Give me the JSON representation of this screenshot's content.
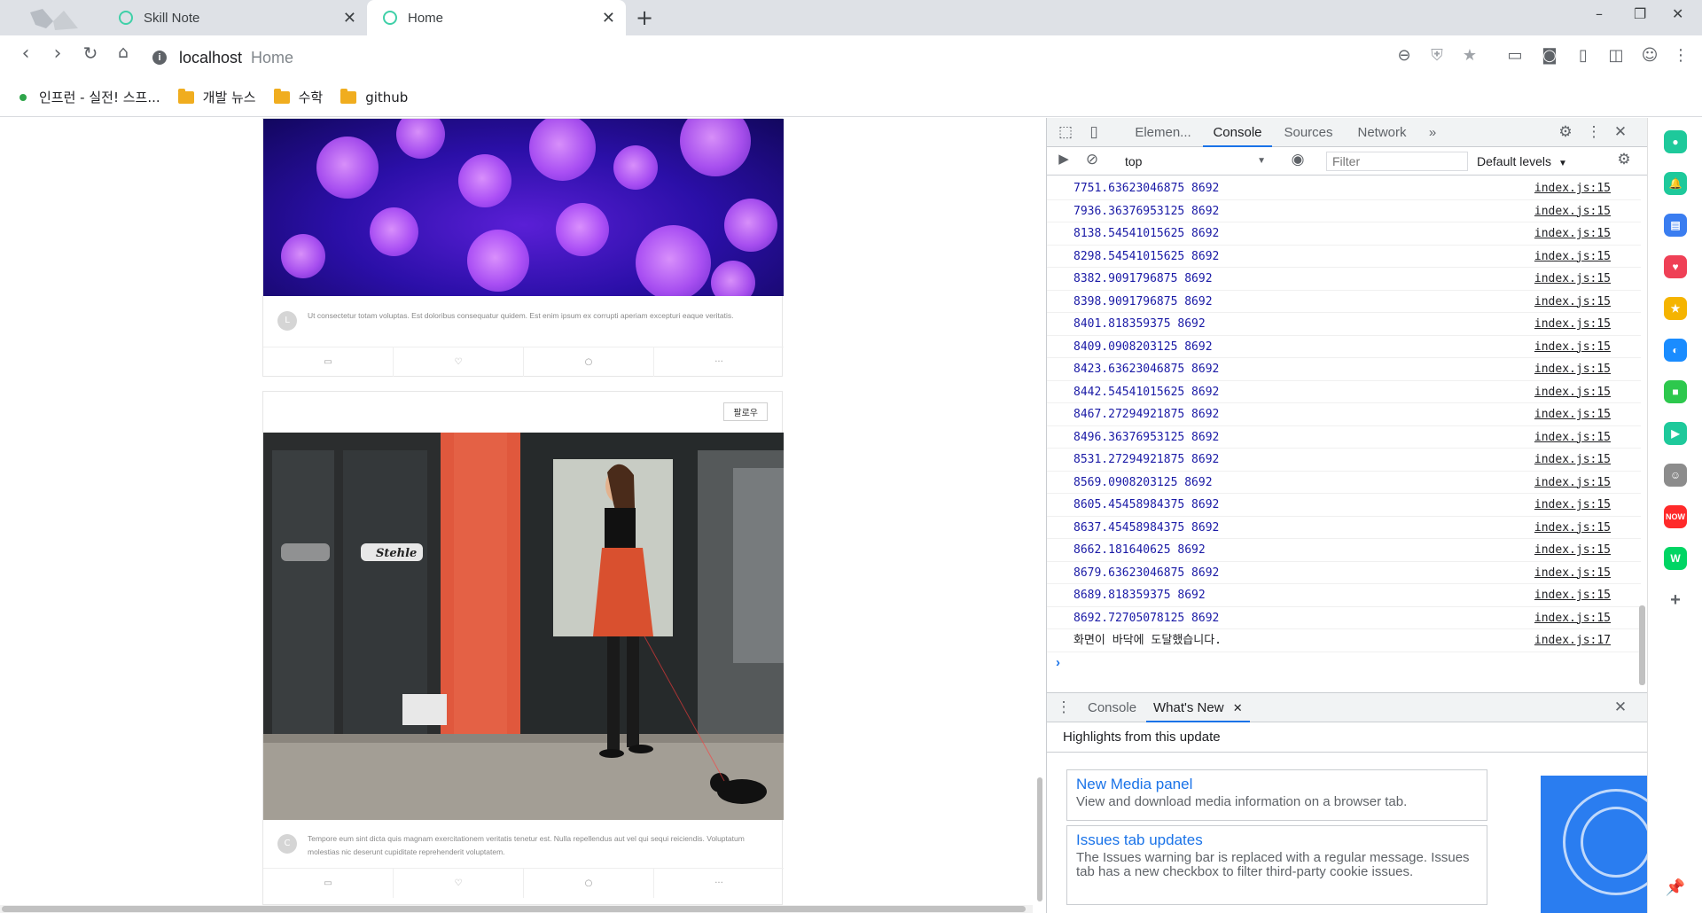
{
  "browser": {
    "tabs": [
      {
        "title": "Skill Note"
      },
      {
        "title": "Home"
      }
    ],
    "new_tab": "+",
    "window_controls": {
      "minimize": "–",
      "restore": "❐",
      "close": "✕"
    },
    "address": {
      "host": "localhost",
      "page_title": "Home",
      "info": "i"
    },
    "bookmarks": [
      {
        "label": "인프런 - 실전! 스프..."
      },
      {
        "label": "개발 뉴스"
      },
      {
        "label": "수학"
      },
      {
        "label": "github"
      }
    ]
  },
  "page": {
    "posts": [
      {
        "image": "purple-bokeh-photo",
        "avatar_initial": "L",
        "caption": "Ut consectetur totam voluptas. Est doloribus consequatur quidem. Est enim ipsum ex corrupti aperiam excepturi eaque veritatis.",
        "actions": [
          "▭",
          "♡",
          "○",
          "···"
        ]
      },
      {
        "follow_label": "팔로우",
        "image": "woman-walking-dog-photo",
        "avatar_initial": "C",
        "caption": "Tempore eum sint dicta quis magnam exercitationem veritatis tenetur est. Nulla repellendus aut vel qui sequi reiciendis. Voluptatum molestias nic deserunt cupiditate reprehenderit voluptatem.",
        "actions": [
          "▭",
          "♡",
          "○",
          "···"
        ]
      }
    ]
  },
  "devtools": {
    "tabs": [
      "Elemen...",
      "Console",
      "Sources",
      "Network",
      "»"
    ],
    "active_tab": "Console",
    "context": "top",
    "filter_placeholder": "Filter",
    "levels": "Default levels",
    "console_rows": [
      {
        "msg": "7751.63623046875 8692",
        "src": "index.js:15"
      },
      {
        "msg": "7936.36376953125 8692",
        "src": "index.js:15"
      },
      {
        "msg": "8138.54541015625 8692",
        "src": "index.js:15"
      },
      {
        "msg": "8298.54541015625 8692",
        "src": "index.js:15"
      },
      {
        "msg": "8382.9091796875 8692",
        "src": "index.js:15"
      },
      {
        "msg": "8398.9091796875 8692",
        "src": "index.js:15"
      },
      {
        "msg": "8401.818359375 8692",
        "src": "index.js:15"
      },
      {
        "msg": "8409.0908203125 8692",
        "src": "index.js:15"
      },
      {
        "msg": "8423.63623046875 8692",
        "src": "index.js:15"
      },
      {
        "msg": "8442.54541015625 8692",
        "src": "index.js:15"
      },
      {
        "msg": "8467.27294921875 8692",
        "src": "index.js:15"
      },
      {
        "msg": "8496.36376953125 8692",
        "src": "index.js:15"
      },
      {
        "msg": "8531.27294921875 8692",
        "src": "index.js:15"
      },
      {
        "msg": "8569.0908203125 8692",
        "src": "index.js:15"
      },
      {
        "msg": "8605.45458984375 8692",
        "src": "index.js:15"
      },
      {
        "msg": "8637.45458984375 8692",
        "src": "index.js:15"
      },
      {
        "msg": "8662.181640625 8692",
        "src": "index.js:15"
      },
      {
        "msg": "8679.63623046875 8692",
        "src": "index.js:15"
      },
      {
        "msg": "8689.818359375 8692",
        "src": "index.js:15"
      },
      {
        "msg": "8692.72705078125 8692",
        "src": "index.js:15"
      },
      {
        "msg": "화면이 바닥에 도달했습니다.",
        "src": "index.js:17",
        "plain": true
      }
    ],
    "drawer": {
      "tabs": [
        "Console",
        "What's New"
      ],
      "active_tab": "What's New",
      "highlights": "Highlights from this update",
      "items": [
        {
          "title": "New Media panel",
          "desc": "View and download media information on a browser tab."
        },
        {
          "title": "Issues tab updates",
          "desc": "The Issues warning bar is replaced with a regular message. Issues tab has a new checkbox to filter third-party cookie issues."
        }
      ]
    }
  },
  "sidepanel": {
    "icons": [
      {
        "name": "whale-space-icon",
        "color": "#1ec99b",
        "glyph": "●"
      },
      {
        "name": "notification-icon",
        "color": "#1ec99b",
        "glyph": "🔔"
      },
      {
        "name": "wallet-icon",
        "color": "#3a7df0",
        "glyph": "▤"
      },
      {
        "name": "pocket-icon",
        "color": "#ef4056",
        "glyph": "♥"
      },
      {
        "name": "favorites-icon",
        "color": "#f5b400",
        "glyph": "★"
      },
      {
        "name": "translate-icon",
        "color": "#1a8cff",
        "glyph": "◐"
      },
      {
        "name": "memo-icon",
        "color": "#2dc84d",
        "glyph": "■"
      },
      {
        "name": "music-icon",
        "color": "#1ec99b",
        "glyph": "▶"
      },
      {
        "name": "papago-icon",
        "color": "#8c8c8c",
        "glyph": "☺"
      },
      {
        "name": "now-icon",
        "color": "#ff2a2a",
        "glyph": "NOW"
      },
      {
        "name": "webtoon-icon",
        "color": "#00d564",
        "glyph": "W"
      }
    ],
    "add": "+"
  }
}
